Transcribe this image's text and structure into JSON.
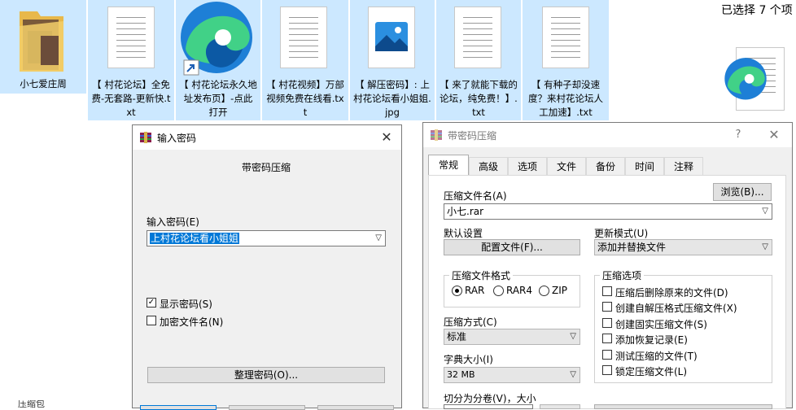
{
  "desktop": {
    "files": [
      {
        "name": "小七爱庄周",
        "icon": "folder-icon"
      },
      {
        "name": "【 村花论坛】全免费-无套路-更新快.txt",
        "icon": "text-file-icon"
      },
      {
        "name": "【 村花论坛永久地址发布页】-点此打开",
        "icon": "edge-shortcut-icon"
      },
      {
        "name": "【 村花视频】万部视频免费在线看.txt",
        "icon": "text-file-icon"
      },
      {
        "name": "【 解压密码】: 上村花论坛看小姐姐.jpg",
        "icon": "image-file-icon"
      },
      {
        "name": "【 来了就能下载的论坛，纯免费！】.txt",
        "icon": "text-file-icon"
      },
      {
        "name": "【 有种子却没速度？来村花论坛人工加速】.txt",
        "icon": "text-file-icon"
      }
    ],
    "selection_status": "已选择 7 个项",
    "bottom_left_fragment": "压缩包"
  },
  "password_dialog": {
    "title": "输入密码",
    "subtitle": "带密码压缩",
    "input_label": "输入密码(E)",
    "password_value": "上村花论坛看小姐姐",
    "show_password_label": "显示密码(S)",
    "show_password_checked": true,
    "encrypt_names_label": "加密文件名(N)",
    "encrypt_names_checked": false,
    "organize_button": "整理密码(O)..."
  },
  "archive_dialog": {
    "title": "带密码压缩",
    "help_glyph": "?",
    "tabs": [
      "常规",
      "高级",
      "选项",
      "文件",
      "备份",
      "时间",
      "注释"
    ],
    "active_tab": "常规",
    "archive_name_label": "压缩文件名(A)",
    "browse_button": "浏览(B)...",
    "archive_name_value": "小七.rar",
    "default_settings_label": "默认设置",
    "profiles_button": "配置文件(F)...",
    "update_mode_label": "更新模式(U)",
    "update_mode_value": "添加并替换文件",
    "format_group_title": "压缩文件格式",
    "formats": [
      "RAR",
      "RAR4",
      "ZIP"
    ],
    "selected_format": "RAR",
    "method_label": "压缩方式(C)",
    "method_value": "标准",
    "dict_label": "字典大小(I)",
    "dict_value": "32 MB",
    "split_label": "切分为分卷(V)，大小",
    "options_group_title": "压缩选项",
    "options": [
      {
        "label": "压缩后删除原来的文件(D)",
        "checked": false
      },
      {
        "label": "创建自解压格式压缩文件(X)",
        "checked": false
      },
      {
        "label": "创建固实压缩文件(S)",
        "checked": false
      },
      {
        "label": "添加恢复记录(E)",
        "checked": false
      },
      {
        "label": "测试压缩的文件(T)",
        "checked": false
      },
      {
        "label": "锁定压缩文件(L)",
        "checked": false
      }
    ]
  },
  "colors": {
    "selection": "#cce8ff",
    "hover": "#d9d9d9",
    "dialog_bg": "#f0f0f0",
    "input_highlight": "#0078d7",
    "edge_blue": "#0c59a4",
    "edge_green": "#41d187"
  }
}
